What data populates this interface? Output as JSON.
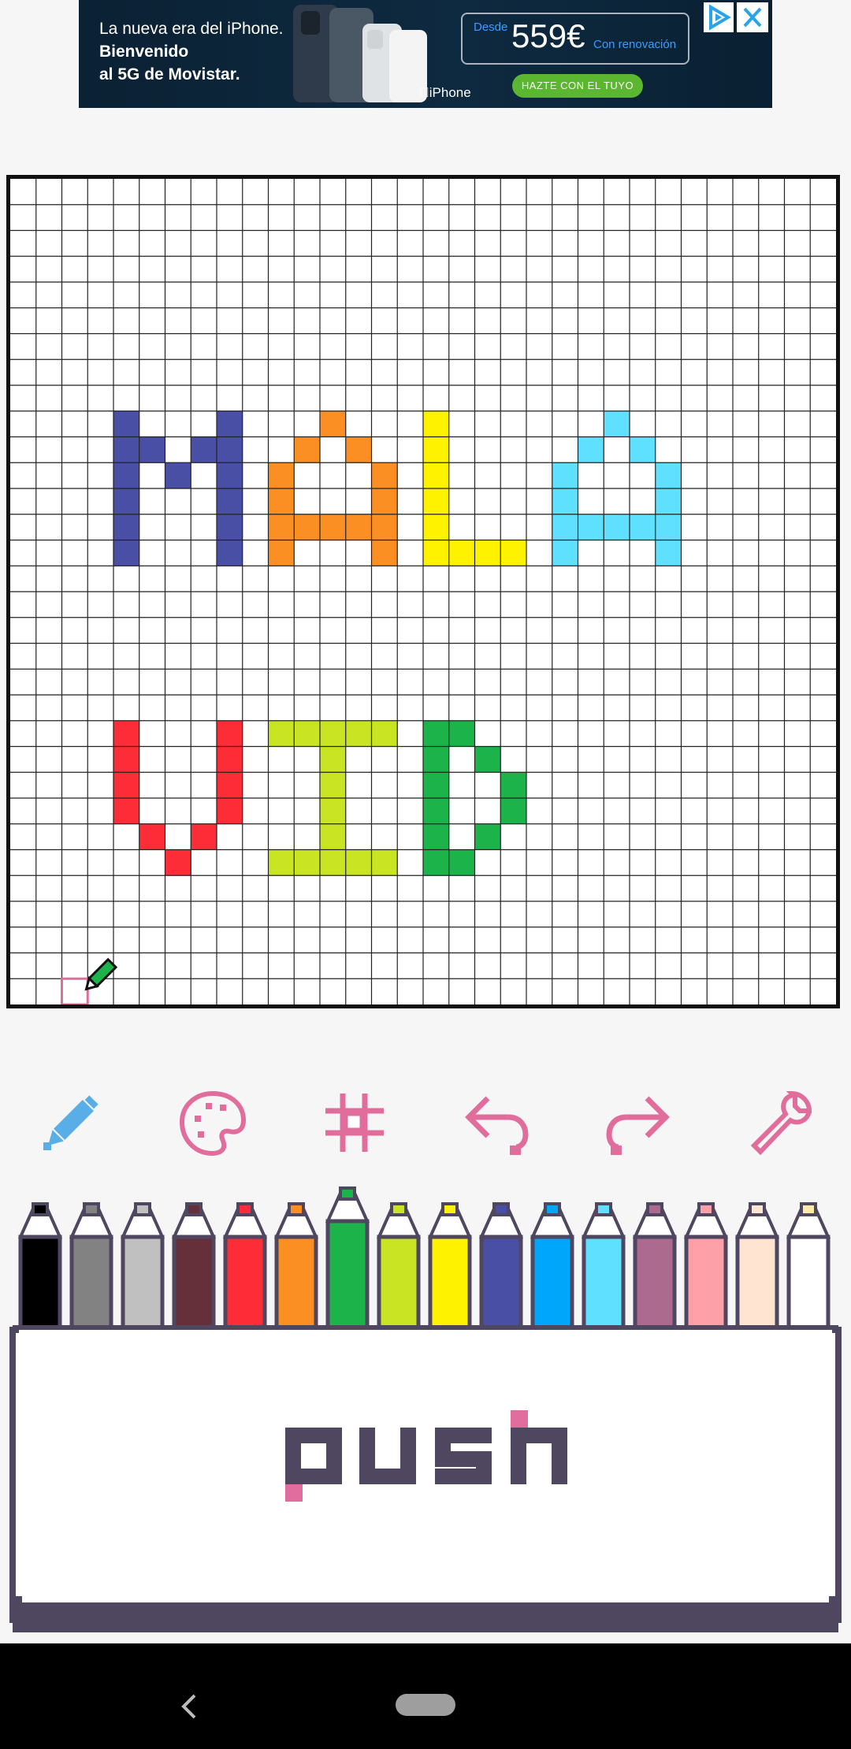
{
  "ad": {
    "headline_line1": "La nueva era del iPhone.",
    "headline_line2": "Bienvenido",
    "headline_line3": "al 5G de Movistar.",
    "price_from": "Desde",
    "price": "559€",
    "price_note": "Con renovación",
    "cta": "HAZTE CON EL TUYO",
    "brand": "iPhone",
    "adchoices_icon": "adchoices-icon",
    "close_icon": "close-icon"
  },
  "canvas": {
    "grid_size": 32,
    "background": "#ffffff",
    "grid_line_color": "#222222",
    "pixels": [
      {
        "color": "#4a4fa6",
        "cells": [
          [
            4,
            9
          ],
          [
            4,
            10
          ],
          [
            4,
            11
          ],
          [
            4,
            12
          ],
          [
            4,
            13
          ],
          [
            4,
            14
          ],
          [
            5,
            10
          ],
          [
            6,
            11
          ],
          [
            7,
            10
          ],
          [
            8,
            9
          ],
          [
            8,
            10
          ],
          [
            8,
            11
          ],
          [
            8,
            12
          ],
          [
            8,
            13
          ],
          [
            8,
            14
          ]
        ]
      },
      {
        "color": "#fb8f24",
        "cells": [
          [
            10,
            11
          ],
          [
            10,
            12
          ],
          [
            10,
            13
          ],
          [
            10,
            14
          ],
          [
            11,
            10
          ],
          [
            11,
            13
          ],
          [
            12,
            9
          ],
          [
            12,
            13
          ],
          [
            13,
            10
          ],
          [
            13,
            13
          ],
          [
            14,
            11
          ],
          [
            14,
            12
          ],
          [
            14,
            13
          ],
          [
            14,
            14
          ]
        ]
      },
      {
        "color": "#fff200",
        "cells": [
          [
            16,
            9
          ],
          [
            16,
            10
          ],
          [
            16,
            11
          ],
          [
            16,
            12
          ],
          [
            16,
            13
          ],
          [
            16,
            14
          ],
          [
            17,
            14
          ],
          [
            18,
            14
          ],
          [
            19,
            14
          ]
        ]
      },
      {
        "color": "#5ee0fe",
        "cells": [
          [
            21,
            11
          ],
          [
            21,
            12
          ],
          [
            21,
            13
          ],
          [
            21,
            14
          ],
          [
            22,
            10
          ],
          [
            22,
            13
          ],
          [
            23,
            9
          ],
          [
            23,
            13
          ],
          [
            24,
            10
          ],
          [
            24,
            13
          ],
          [
            25,
            11
          ],
          [
            25,
            12
          ],
          [
            25,
            13
          ],
          [
            25,
            14
          ]
        ]
      },
      {
        "color": "#fc2d36",
        "cells": [
          [
            4,
            21
          ],
          [
            4,
            22
          ],
          [
            4,
            23
          ],
          [
            4,
            24
          ],
          [
            5,
            25
          ],
          [
            6,
            26
          ],
          [
            7,
            25
          ],
          [
            8,
            21
          ],
          [
            8,
            22
          ],
          [
            8,
            23
          ],
          [
            8,
            24
          ]
        ]
      },
      {
        "color": "#c8e423",
        "cells": [
          [
            10,
            21
          ],
          [
            11,
            21
          ],
          [
            12,
            21
          ],
          [
            13,
            21
          ],
          [
            14,
            21
          ],
          [
            12,
            22
          ],
          [
            12,
            23
          ],
          [
            12,
            24
          ],
          [
            12,
            25
          ],
          [
            10,
            26
          ],
          [
            11,
            26
          ],
          [
            12,
            26
          ],
          [
            13,
            26
          ],
          [
            14,
            26
          ]
        ]
      },
      {
        "color": "#1db34b",
        "cells": [
          [
            16,
            21
          ],
          [
            16,
            22
          ],
          [
            16,
            23
          ],
          [
            16,
            24
          ],
          [
            16,
            25
          ],
          [
            16,
            26
          ],
          [
            17,
            21
          ],
          [
            17,
            26
          ],
          [
            18,
            22
          ],
          [
            18,
            25
          ],
          [
            19,
            23
          ],
          [
            19,
            24
          ]
        ]
      }
    ],
    "cursor_icon": "pencil-cursor-icon"
  },
  "toolbar": [
    {
      "name": "pencil-tool-icon",
      "color": "#5aaee8"
    },
    {
      "name": "palette-tool-icon",
      "color": "#e16d9c"
    },
    {
      "name": "grid-tool-icon",
      "color": "#e16d9c"
    },
    {
      "name": "undo-icon",
      "color": "#e16d9c"
    },
    {
      "name": "redo-icon",
      "color": "#e16d9c"
    },
    {
      "name": "wrench-settings-icon",
      "color": "#e16d9c"
    }
  ],
  "palette": {
    "selected_index": 6,
    "colors": [
      "#000000",
      "#828282",
      "#c0c0c0",
      "#66303a",
      "#fc2d36",
      "#fb8f24",
      "#1db34b",
      "#c8e423",
      "#fff200",
      "#4a4fa6",
      "#00a6f9",
      "#5ee0fe",
      "#ad6a8f",
      "#fea0a8",
      "#ffe4d2",
      "#ffffff"
    ],
    "tips": [
      "#000000",
      "#828282",
      "#c0c0c0",
      "#66303a",
      "#fc2d36",
      "#fb8f24",
      "#1db34b",
      "#c8e423",
      "#fff200",
      "#4a4fa6",
      "#00a6f9",
      "#5ee0fe",
      "#ad6a8f",
      "#fea0a8",
      "#ffe4d2",
      "#ffeaa6"
    ]
  },
  "push_button": {
    "label": "push",
    "text_color": "#4f4660",
    "accent_color": "#e16d9c"
  },
  "navbar": {
    "back_icon": "back-icon",
    "home_icon": "home-pill-icon"
  }
}
